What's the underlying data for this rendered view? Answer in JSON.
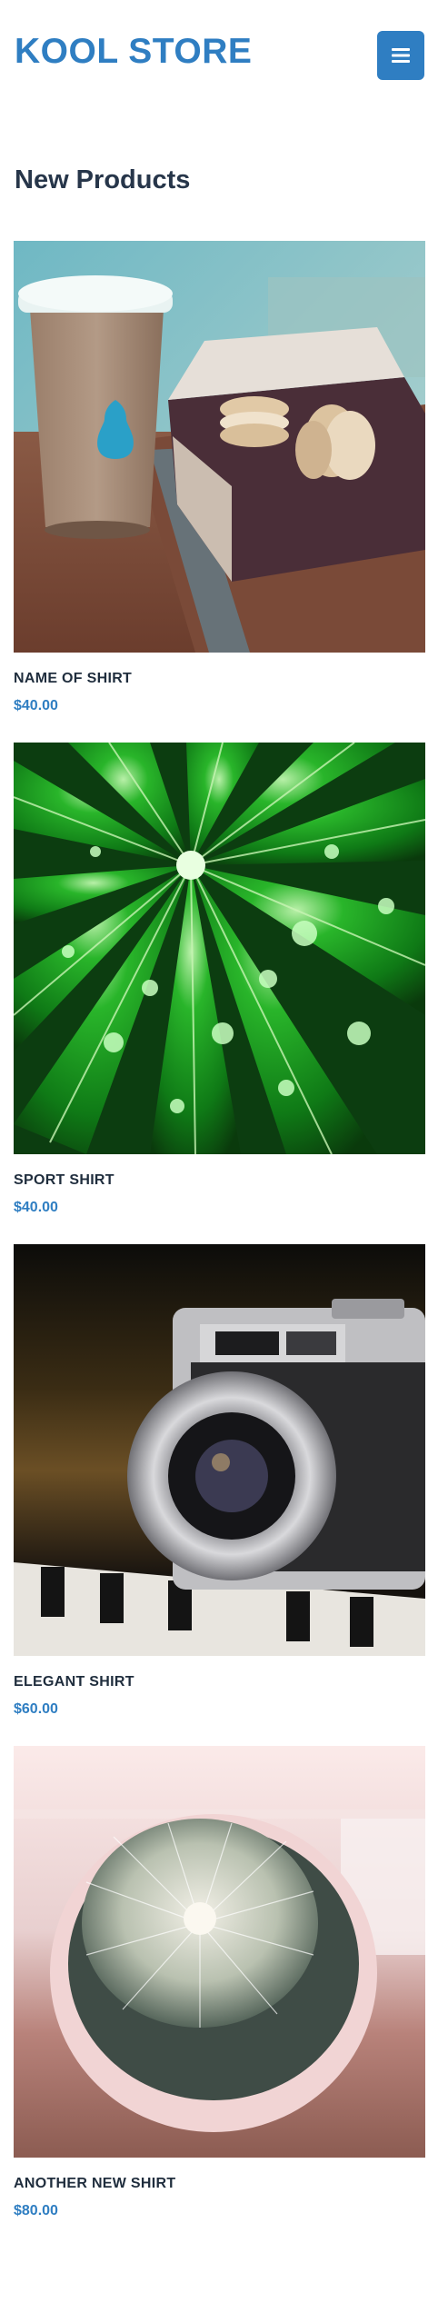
{
  "header": {
    "brand": "KOOL STORE",
    "menu_icon": "hamburger-menu-icon"
  },
  "section": {
    "title": "New Products"
  },
  "products": [
    {
      "name": "NAME OF SHIRT",
      "price": "$40.00",
      "image": "coffee-cup-and-macarons-photo"
    },
    {
      "name": "SPORT SHIRT",
      "price": "$40.00",
      "image": "green-leaf-with-water-drops-photo"
    },
    {
      "name": "ELEGANT SHIRT",
      "price": "$60.00",
      "image": "vintage-camera-on-piano-photo"
    },
    {
      "name": "ANOTHER NEW SHIRT",
      "price": "$80.00",
      "image": "potted-cactus-photo"
    }
  ],
  "colors": {
    "brand": "#2f7ec2",
    "heading": "#27364a",
    "text": "#1f2d3d"
  }
}
